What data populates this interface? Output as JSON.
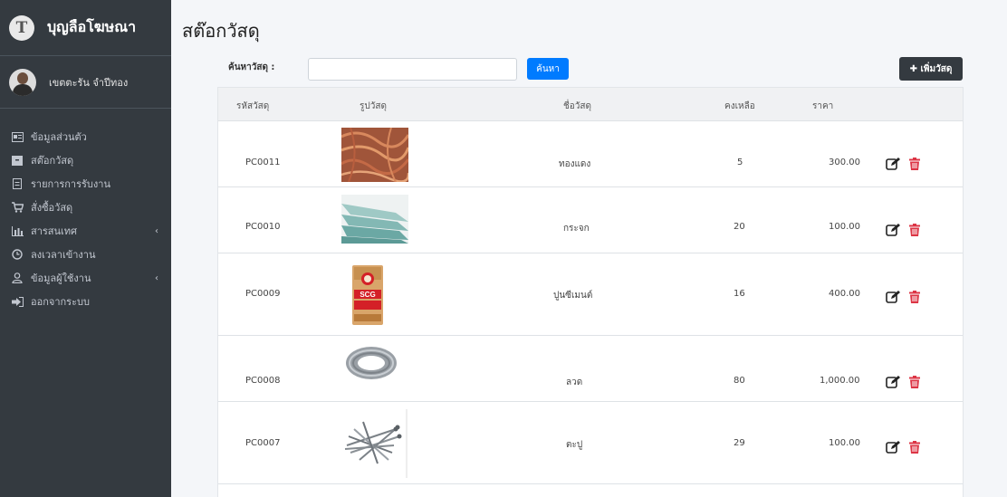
{
  "brand": {
    "name": "บุญลือโฆษณา",
    "logo_letter": "T"
  },
  "user": {
    "name": "เขตตะรัน จำปีทอง"
  },
  "sidebar": {
    "items": [
      {
        "label": "ข้อมูลส่วนตัว",
        "icon": "id-card-icon"
      },
      {
        "label": "สต๊อกวัสดุ",
        "icon": "box-icon"
      },
      {
        "label": "รายการการรับงาน",
        "icon": "document-icon"
      },
      {
        "label": "สั่งซื้อวัสดุ",
        "icon": "cart-icon"
      },
      {
        "label": "สารสนเทศ",
        "icon": "bar-chart-icon",
        "has_submenu": true
      },
      {
        "label": "ลงเวลาเข้างาน",
        "icon": "clock-icon"
      },
      {
        "label": "ข้อมูลผู้ใช้งาน",
        "icon": "user-icon",
        "has_submenu": true
      },
      {
        "label": "ออกจากระบบ",
        "icon": "logout-icon"
      }
    ]
  },
  "main": {
    "title": "สต๊อกวัสดุ",
    "search": {
      "label": "ค้นหาวัสดุ :",
      "value": "",
      "placeholder": "",
      "button": "ค้นหา"
    },
    "add_button": "✚ เพิ่มวัสดุ",
    "table": {
      "headers": [
        "รหัสวัสดุ",
        "รูปวัสดุ",
        "ชื่อวัสดุ",
        "คงเหลือ",
        "ราคา"
      ],
      "rows": [
        {
          "code": "PC0011",
          "image": "copper-wire-image",
          "name": "ทองแดง",
          "qty": "5",
          "price": "300.00"
        },
        {
          "code": "PC0010",
          "image": "glass-sheet-image",
          "name": "กระจก",
          "qty": "20",
          "price": "100.00"
        },
        {
          "code": "PC0009",
          "image": "cement-bag-image",
          "name": "ปูนซีเมนต์",
          "qty": "16",
          "price": "400.00",
          "image_text": "SCG"
        },
        {
          "code": "PC0008",
          "image": "wire-coil-image",
          "name": "ลวด",
          "qty": "80",
          "price": "1,000.00"
        },
        {
          "code": "PC0007",
          "image": "nails-image",
          "name": "ตะปู",
          "qty": "29",
          "price": "100.00"
        }
      ]
    }
  },
  "colors": {
    "sidebar_bg": "#343a40",
    "primary": "#007bff",
    "danger": "#dc3545",
    "dark_button": "#343a40"
  }
}
